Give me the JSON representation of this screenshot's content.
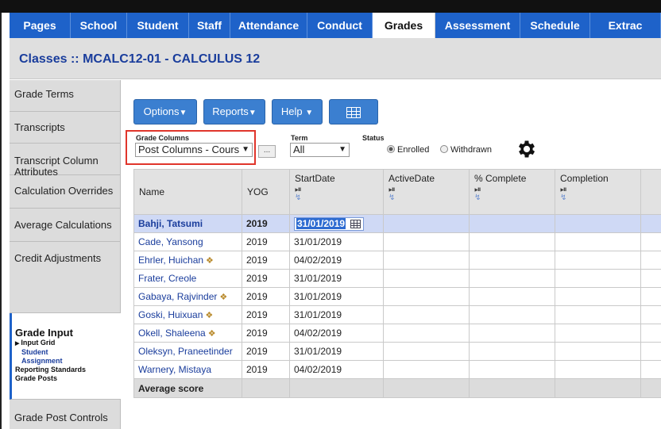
{
  "nav": {
    "tabs": [
      {
        "label": "Pages",
        "width": 77
      },
      {
        "label": "School",
        "width": 71
      },
      {
        "label": "Student",
        "width": 78
      },
      {
        "label": "Staff",
        "width": 52
      },
      {
        "label": "Attendance",
        "width": 97
      },
      {
        "label": "Conduct",
        "width": 82
      },
      {
        "label": "Grades",
        "width": 79,
        "active": true
      },
      {
        "label": "Assessment",
        "width": 107
      },
      {
        "label": "Schedule",
        "width": 88
      },
      {
        "label": "Extrac",
        "width": 89
      }
    ]
  },
  "page": {
    "title_prefix": "Classes",
    "title_sep": "::",
    "title_main": "MCALC12-01 - CALCULUS 12"
  },
  "sidemenu": {
    "items": [
      {
        "label": "Grade Terms"
      },
      {
        "label": "Transcripts"
      },
      {
        "label": "Transcript Column Attributes"
      },
      {
        "label": "Calculation Overrides"
      },
      {
        "label": "Average Calculations"
      },
      {
        "label": "Credit Adjustments"
      },
      {
        "label": "Grade Post Controls"
      }
    ],
    "grade_input": {
      "title": "Grade Input",
      "input_grid": "Input Grid",
      "student": "Student",
      "assignment": "Assignment",
      "reporting_standards": "Reporting Standards",
      "grade_posts": "Grade Posts"
    }
  },
  "toolbar": {
    "options": "Options",
    "reports": "Reports",
    "help": "Help",
    "grid_icon": "grid-icon"
  },
  "filters": {
    "grade_columns_label": "Grade Columns",
    "grade_columns_value": "Post Columns - Cours",
    "dots": "...",
    "term_label": "Term",
    "term_value": "All",
    "status_label": "Status",
    "enrolled": "Enrolled",
    "withdrawn": "Withdrawn",
    "status_selected": "Enrolled"
  },
  "table": {
    "headers": {
      "name": "Name",
      "yog": "YOG",
      "start": "StartDate",
      "active": "ActiveDate",
      "complete": "% Complete",
      "completion": "Completion"
    },
    "rows": [
      {
        "name": "Bahji, Tatsumi",
        "yog": "2019",
        "start": "31/01/2019",
        "selected": true
      },
      {
        "name": "Cade, Yansong",
        "yog": "2019",
        "start": "31/01/2019"
      },
      {
        "name": "Ehrler, Huichan",
        "yog": "2019",
        "start": "04/02/2019",
        "icon": true
      },
      {
        "name": "Frater, Creole",
        "yog": "2019",
        "start": "31/01/2019"
      },
      {
        "name": "Gabaya, Rajvinder",
        "yog": "2019",
        "start": "31/01/2019",
        "icon": true
      },
      {
        "name": "Goski, Huixuan",
        "yog": "2019",
        "start": "31/01/2019",
        "icon": true
      },
      {
        "name": "Okell, Shaleena",
        "yog": "2019",
        "start": "04/02/2019",
        "icon": true
      },
      {
        "name": "Oleksyn, Praneetinder",
        "yog": "2019",
        "start": "31/01/2019"
      },
      {
        "name": "Warnery, Mistaya",
        "yog": "2019",
        "start": "04/02/2019"
      }
    ],
    "average_label": "Average score"
  },
  "colors": {
    "nav_bg": "#1e62c9",
    "highlight_row": "#cfd9f5",
    "button_blue": "#3b7fd0",
    "annotation_red": "#e0352b"
  }
}
